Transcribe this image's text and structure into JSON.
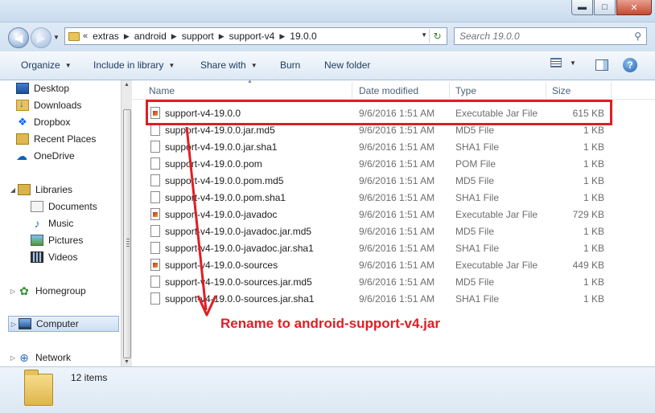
{
  "window": {
    "buttons": [
      "minimize",
      "maximize",
      "close"
    ],
    "minimize_glyph": "▬",
    "maximize_glyph": "□",
    "close_glyph": "✕"
  },
  "address_bar": {
    "overflow_chevron": "«",
    "breadcrumbs": [
      "extras",
      "android",
      "support",
      "support-v4",
      "19.0.0"
    ],
    "search_placeholder": "Search 19.0.0"
  },
  "toolbar": {
    "organize": "Organize",
    "include_in_library": "Include in library",
    "share_with": "Share with",
    "burn": "Burn",
    "new_folder": "New folder",
    "help_glyph": "?"
  },
  "nav": {
    "favorites": [
      "Desktop",
      "Downloads",
      "Dropbox",
      "Recent Places",
      "OneDrive"
    ],
    "libraries": "Libraries",
    "library_items": [
      "Documents",
      "Music",
      "Pictures",
      "Videos"
    ],
    "homegroup": "Homegroup",
    "computer": "Computer",
    "network": "Network"
  },
  "columns": {
    "name": "Name",
    "date_modified": "Date modified",
    "type": "Type",
    "size": "Size"
  },
  "files": [
    {
      "name": "support-v4-19.0.0",
      "date": "9/6/2016 1:51 AM",
      "type": "Executable Jar File",
      "size": "615 KB",
      "icon": "jar-file-icon"
    },
    {
      "name": "support-v4-19.0.0.jar.md5",
      "date": "9/6/2016 1:51 AM",
      "type": "MD5 File",
      "size": "1 KB",
      "icon": "blank-file-icon"
    },
    {
      "name": "support-v4-19.0.0.jar.sha1",
      "date": "9/6/2016 1:51 AM",
      "type": "SHA1 File",
      "size": "1 KB",
      "icon": "blank-file-icon"
    },
    {
      "name": "support-v4-19.0.0.pom",
      "date": "9/6/2016 1:51 AM",
      "type": "POM File",
      "size": "1 KB",
      "icon": "blank-file-icon"
    },
    {
      "name": "support-v4-19.0.0.pom.md5",
      "date": "9/6/2016 1:51 AM",
      "type": "MD5 File",
      "size": "1 KB",
      "icon": "blank-file-icon"
    },
    {
      "name": "support-v4-19.0.0.pom.sha1",
      "date": "9/6/2016 1:51 AM",
      "type": "SHA1 File",
      "size": "1 KB",
      "icon": "blank-file-icon"
    },
    {
      "name": "support-v4-19.0.0-javadoc",
      "date": "9/6/2016 1:51 AM",
      "type": "Executable Jar File",
      "size": "729 KB",
      "icon": "jar-file-icon"
    },
    {
      "name": "support-v4-19.0.0-javadoc.jar.md5",
      "date": "9/6/2016 1:51 AM",
      "type": "MD5 File",
      "size": "1 KB",
      "icon": "blank-file-icon"
    },
    {
      "name": "support-v4-19.0.0-javadoc.jar.sha1",
      "date": "9/6/2016 1:51 AM",
      "type": "SHA1 File",
      "size": "1 KB",
      "icon": "blank-file-icon"
    },
    {
      "name": "support-v4-19.0.0-sources",
      "date": "9/6/2016 1:51 AM",
      "type": "Executable Jar File",
      "size": "449 KB",
      "icon": "jar-file-icon"
    },
    {
      "name": "support-v4-19.0.0-sources.jar.md5",
      "date": "9/6/2016 1:51 AM",
      "type": "MD5 File",
      "size": "1 KB",
      "icon": "blank-file-icon"
    },
    {
      "name": "support-v4-19.0.0-sources.jar.sha1",
      "date": "9/6/2016 1:51 AM",
      "type": "SHA1 File",
      "size": "1 KB",
      "icon": "blank-file-icon"
    }
  ],
  "status": {
    "item_count": "12 items"
  },
  "annotation": {
    "text": "Rename to android-support-v4.jar",
    "color": "#e11d24"
  }
}
